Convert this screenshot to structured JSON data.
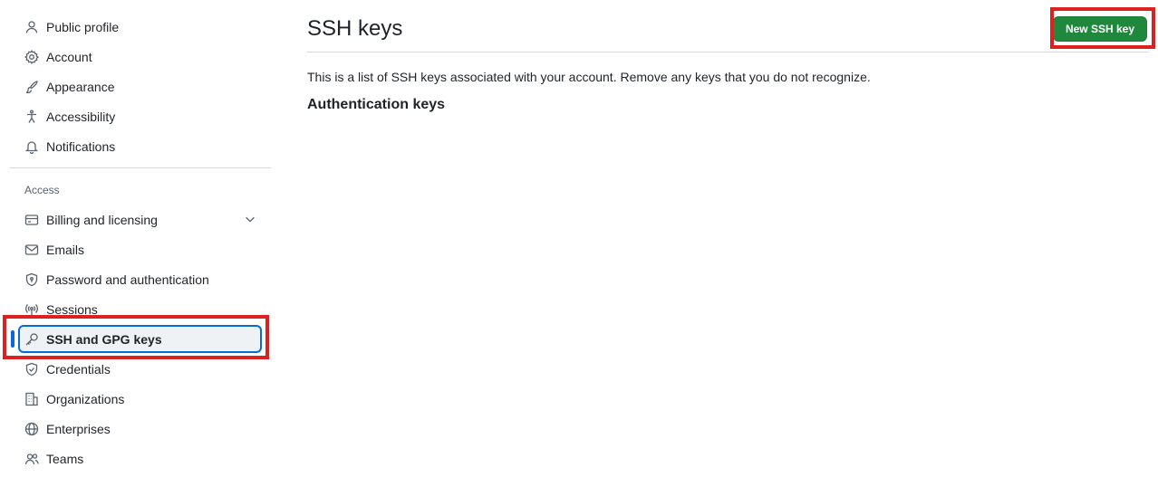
{
  "sidebar": {
    "top_items": [
      {
        "label": "Public profile",
        "icon": "person-icon"
      },
      {
        "label": "Account",
        "icon": "gear-icon"
      },
      {
        "label": "Appearance",
        "icon": "paintbrush-icon"
      },
      {
        "label": "Accessibility",
        "icon": "accessibility-icon"
      },
      {
        "label": "Notifications",
        "icon": "bell-icon"
      }
    ],
    "access_label": "Access",
    "access_items": [
      {
        "label": "Billing and licensing",
        "icon": "credit-card-icon"
      },
      {
        "label": "Emails",
        "icon": "mail-icon"
      },
      {
        "label": "Password and authentication",
        "icon": "shield-lock-icon"
      },
      {
        "label": "Sessions",
        "icon": "broadcast-icon"
      },
      {
        "label": "SSH and GPG keys",
        "icon": "key-icon"
      },
      {
        "label": "Credentials",
        "icon": "shield-check-icon"
      },
      {
        "label": "Organizations",
        "icon": "organization-icon"
      },
      {
        "label": "Enterprises",
        "icon": "globe-icon"
      },
      {
        "label": "Teams",
        "icon": "people-icon"
      }
    ]
  },
  "main": {
    "title": "SSH keys",
    "new_key_button": "New SSH key",
    "description": "This is a list of SSH keys associated with your account. Remove any keys that you do not recognize.",
    "section_title": "Authentication keys"
  },
  "colors": {
    "primary_button": "#1f883d",
    "active_accent": "#0969da",
    "annotation_red": "#dd2020"
  }
}
